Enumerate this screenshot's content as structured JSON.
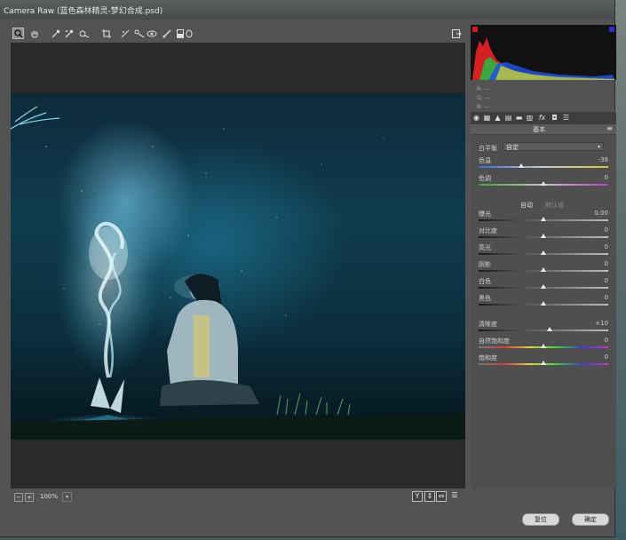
{
  "window": {
    "title": "Camera Raw (蓝色森林精灵-梦幻合成.psd)"
  },
  "toolbar": {
    "tools": [
      "zoom-tool",
      "hand-tool",
      "white-balance-tool",
      "color-sampler-tool",
      "targeted-adjustment-tool",
      "crop-tool",
      "straighten-tool",
      "spot-removal-tool",
      "red-eye-tool",
      "adjustment-brush-tool",
      "graduated-filter-tool",
      "radial-filter-tool"
    ],
    "fullscreen_icon": "fullscreen-toggle-icon"
  },
  "readout": {
    "r_label": "R:",
    "r_value": "---",
    "g_label": "G:",
    "g_value": "---",
    "b_label": "B:",
    "b_value": "---"
  },
  "panel": {
    "title": "基本",
    "white_balance_label": "白平衡",
    "white_balance_value": "自定",
    "auto_label": "自动",
    "default_label": "默认值",
    "sliders": [
      {
        "label": "色温",
        "value": "-38",
        "pos": 0.33,
        "track": "temp"
      },
      {
        "label": "色调",
        "value": "0",
        "pos": 0.5,
        "track": "tint"
      },
      {
        "label": "曝光",
        "value": "0.00",
        "pos": 0.5,
        "track": "gray"
      },
      {
        "label": "对比度",
        "value": "0",
        "pos": 0.5,
        "track": "gray"
      },
      {
        "label": "高光",
        "value": "0",
        "pos": 0.5,
        "track": "gray"
      },
      {
        "label": "阴影",
        "value": "0",
        "pos": 0.5,
        "track": "gray"
      },
      {
        "label": "白色",
        "value": "0",
        "pos": 0.5,
        "track": "gray"
      },
      {
        "label": "黑色",
        "value": "0",
        "pos": 0.5,
        "track": "gray"
      },
      {
        "label": "清晰度",
        "value": "+10",
        "pos": 0.55,
        "track": "gray"
      },
      {
        "label": "自然饱和度",
        "value": "0",
        "pos": 0.5,
        "track": "color"
      },
      {
        "label": "饱和度",
        "value": "0",
        "pos": 0.5,
        "track": "color"
      }
    ]
  },
  "bottom": {
    "zoom_value": "100%",
    "view_buttons": [
      "Y",
      "⇕",
      "⇔",
      "☰"
    ]
  },
  "buttons": {
    "reset": "复位",
    "ok": "确定"
  },
  "colors": {
    "clip_warning_shadow": "#d11d1d",
    "clip_warning_highlight": "#2a2ad8"
  }
}
